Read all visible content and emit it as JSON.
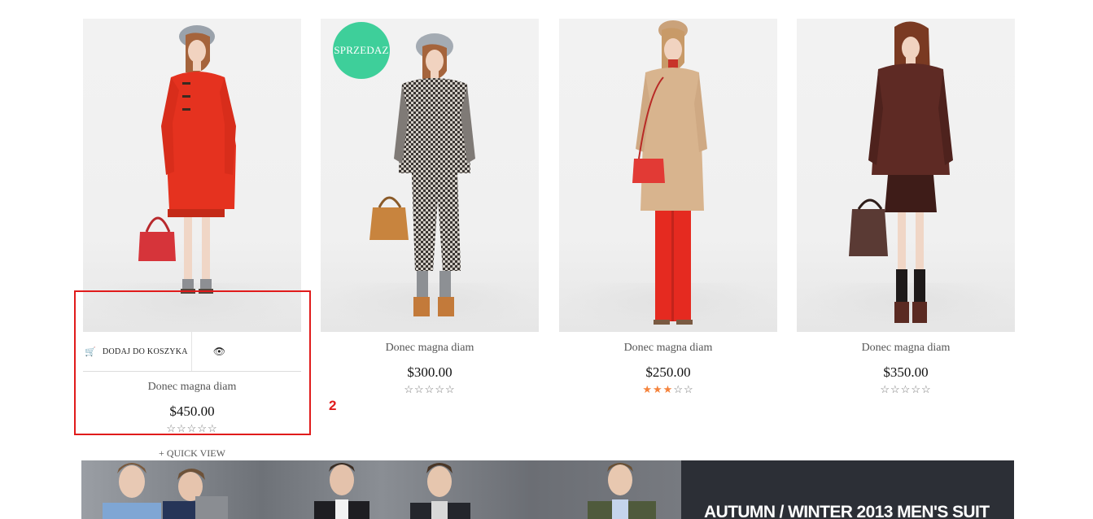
{
  "products": [
    {
      "name": "Donec magna diam",
      "price": "$450.00",
      "stars": "☆☆☆☆☆",
      "add_to_cart_label": "DODAJ DO KOSZYKA",
      "quick_view_label": "QUICK VIEW",
      "quick_view_plus": "+"
    },
    {
      "badge": "SPRZEDAZ",
      "name": "Donec magna diam",
      "price": "$300.00",
      "stars": "☆☆☆☆☆"
    },
    {
      "name": "Donec magna diam",
      "price": "$250.00",
      "stars_on": "★★★",
      "stars_off": "☆☆"
    },
    {
      "name": "Donec magna diam",
      "price": "$350.00",
      "stars": "☆☆☆☆☆"
    }
  ],
  "icons": {
    "cart": "shopping-cart-icon",
    "eye": "eye-icon"
  },
  "annotation": {
    "number": "2",
    "color": "#e01b1b"
  },
  "banner": {
    "title": "AUTUMN / WINTER 2013 MEN'S SUIT"
  },
  "colors": {
    "sale_badge": "#3ecf9a",
    "star_active": "#f5833c"
  }
}
